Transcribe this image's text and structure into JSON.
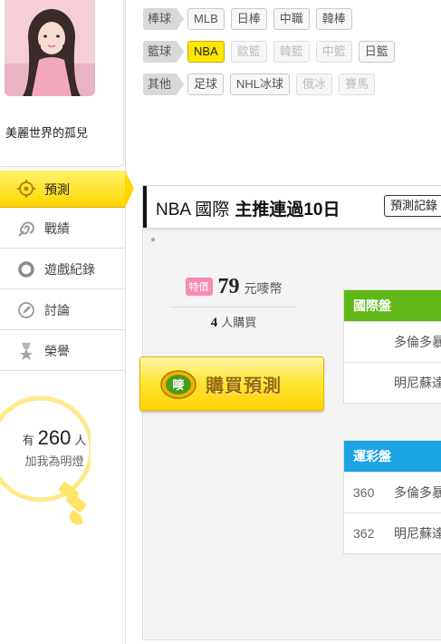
{
  "user": {
    "name": "美麗世界的孤兒"
  },
  "nav": {
    "items": [
      {
        "label": "預測",
        "icon": "target-icon",
        "active": true
      },
      {
        "label": "戰績",
        "icon": "spiral-icon",
        "active": false
      },
      {
        "label": "遊戲紀錄",
        "icon": "ring-icon",
        "active": false
      },
      {
        "label": "討論",
        "icon": "pencil-icon",
        "active": false
      },
      {
        "label": "榮譽",
        "icon": "medal-icon",
        "active": false
      }
    ]
  },
  "fans": {
    "prefix": "有",
    "count": "260",
    "suffix": "人",
    "line2": "加我為明燈"
  },
  "categories": [
    {
      "head": "棒球",
      "tags": [
        {
          "label": "MLB",
          "state": "normal"
        },
        {
          "label": "日棒",
          "state": "normal"
        },
        {
          "label": "中職",
          "state": "normal"
        },
        {
          "label": "韓棒",
          "state": "normal"
        }
      ]
    },
    {
      "head": "籃球",
      "tags": [
        {
          "label": "NBA",
          "state": "on"
        },
        {
          "label": "歐籃",
          "state": "off"
        },
        {
          "label": "韓籃",
          "state": "off"
        },
        {
          "label": "中籃",
          "state": "off"
        },
        {
          "label": "日籃",
          "state": "normal"
        }
      ]
    },
    {
      "head": "其他",
      "tags": [
        {
          "label": "足球",
          "state": "normal"
        },
        {
          "label": "NHL冰球",
          "state": "normal"
        },
        {
          "label": "俄冰",
          "state": "off"
        },
        {
          "label": "賽馬",
          "state": "off"
        }
      ]
    }
  ],
  "panel": {
    "title": "NBA 國際",
    "title_bold": "主推連過10日",
    "record_button": "預測記錄",
    "special_badge": "特價",
    "price": "79",
    "price_unit": "元嘜幣",
    "buyers_count": "4",
    "buyers_suffix": "人購買",
    "buy_button": "購買預測",
    "buy_icon_text": "嘜"
  },
  "markets": [
    {
      "title": "國際盤",
      "color": "#5fb817",
      "rows": [
        {
          "code": "",
          "team": "多倫多暴"
        },
        {
          "code": "",
          "team": "明尼蘇達"
        }
      ]
    },
    {
      "title": "運彩盤",
      "color": "#1ca3e3",
      "rows": [
        {
          "code": "360",
          "team": "多倫多暴"
        },
        {
          "code": "362",
          "team": "明尼蘇達"
        }
      ]
    }
  ]
}
